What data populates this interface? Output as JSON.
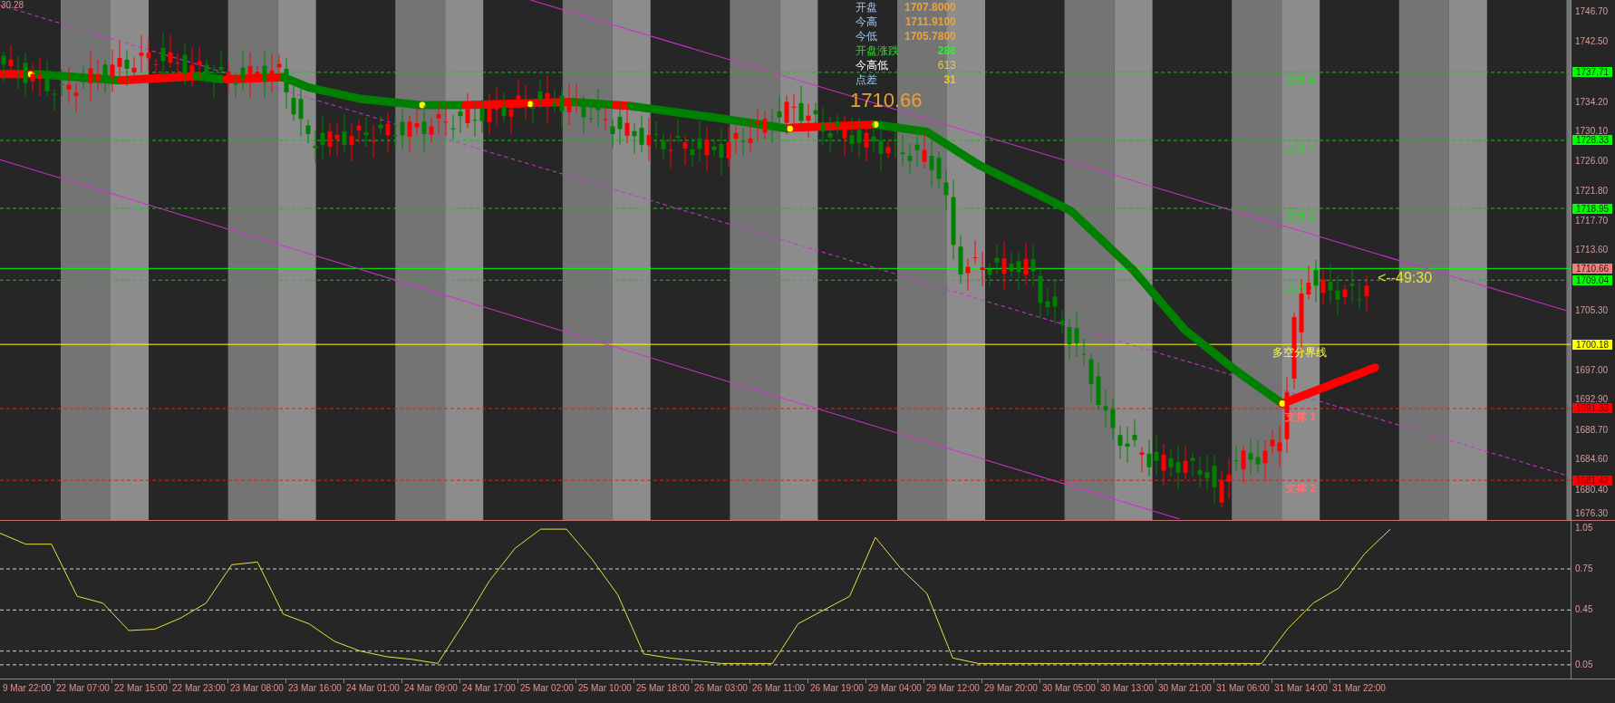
{
  "corner_label": "30.28",
  "info_panel": [
    {
      "kind": "price",
      "label": "开盘",
      "value": "1707.8000"
    },
    {
      "kind": "price",
      "label": "今高",
      "value": "1711.9100"
    },
    {
      "kind": "price",
      "label": "今低",
      "value": "1705.7800"
    },
    {
      "kind": "change",
      "label": "开盘涨跌",
      "value": "286"
    },
    {
      "kind": "range",
      "label": "今高低",
      "value": "613"
    },
    {
      "kind": "spread",
      "label": "点差",
      "value": "31"
    }
  ],
  "current_price": "1710.66",
  "countdown": "<--49:30",
  "levels": [
    {
      "kind": "resistance",
      "label": "压力 4",
      "tag": "1737.71"
    },
    {
      "kind": "resistance",
      "label": "压力 3",
      "tag": "1728.33"
    },
    {
      "kind": "resistance",
      "label": "压力 2",
      "tag": "1718.95"
    },
    {
      "kind": "bid",
      "tag": "1710.66"
    },
    {
      "kind": "resistance",
      "label": "压力 1",
      "tag": "1709.04"
    },
    {
      "kind": "pivot",
      "label": "多空分界线",
      "tag": "1700.18"
    },
    {
      "kind": "support",
      "label": "支撑 1",
      "tag": "1691.33"
    },
    {
      "kind": "support",
      "label": "支撑 2",
      "tag": "1681.42"
    }
  ],
  "price_axis": [
    "1746.70",
    "1742.50",
    "1734.20",
    "1730.10",
    "1726.00",
    "1721.80",
    "1717.70",
    "1713.60",
    "1705.30",
    "1697.00",
    "1692.90",
    "1688.70",
    "1684.60",
    "1680.40",
    "1676.30"
  ],
  "oscillator": {
    "chart_data": {
      "type": "line",
      "grid": true,
      "ylim": [
        -0.05,
        1.1
      ],
      "yticks": [
        {
          "value": 1.05,
          "label": "1.05"
        },
        {
          "value": 0.75,
          "label": "0.75"
        },
        {
          "value": 0.45,
          "label": "0.45"
        },
        {
          "value": 0.05,
          "label": "0.05"
        }
      ],
      "values": [
        1.01,
        0.93,
        0.93,
        0.55,
        0.5,
        0.3,
        0.31,
        0.39,
        0.5,
        0.78,
        0.8,
        0.42,
        0.35,
        0.22,
        0.15,
        0.11,
        0.09,
        0.06,
        0.35,
        0.66,
        0.9,
        1.04,
        1.04,
        0.82,
        0.56,
        0.13,
        0.1,
        0.08,
        0.06,
        0.06,
        0.06,
        0.35,
        0.45,
        0.55,
        0.98,
        0.75,
        0.57,
        0.1,
        0.06,
        0.06,
        0.06,
        0.06,
        0.06,
        0.06,
        0.06,
        0.06,
        0.06,
        0.06,
        0.06,
        0.06,
        0.31,
        0.5,
        0.61,
        0.86,
        1.04
      ]
    }
  },
  "time_axis": [
    "9 Mar 22:00",
    "22 Mar 07:00",
    "22 Mar 15:00",
    "22 Mar 23:00",
    "23 Mar 08:00",
    "23 Mar 16:00",
    "24 Mar 01:00",
    "24 Mar 09:00",
    "24 Mar 17:00",
    "25 Mar 02:00",
    "25 Mar 10:00",
    "25 Mar 18:00",
    "26 Mar 03:00",
    "26 Mar 11:00",
    "26 Mar 19:00",
    "29 Mar 04:00",
    "29 Mar 12:00",
    "29 Mar 20:00",
    "30 Mar 05:00",
    "30 Mar 13:00",
    "30 Mar 21:00",
    "31 Mar 06:00",
    "31 Mar 14:00",
    "31 Mar 22:00"
  ]
}
